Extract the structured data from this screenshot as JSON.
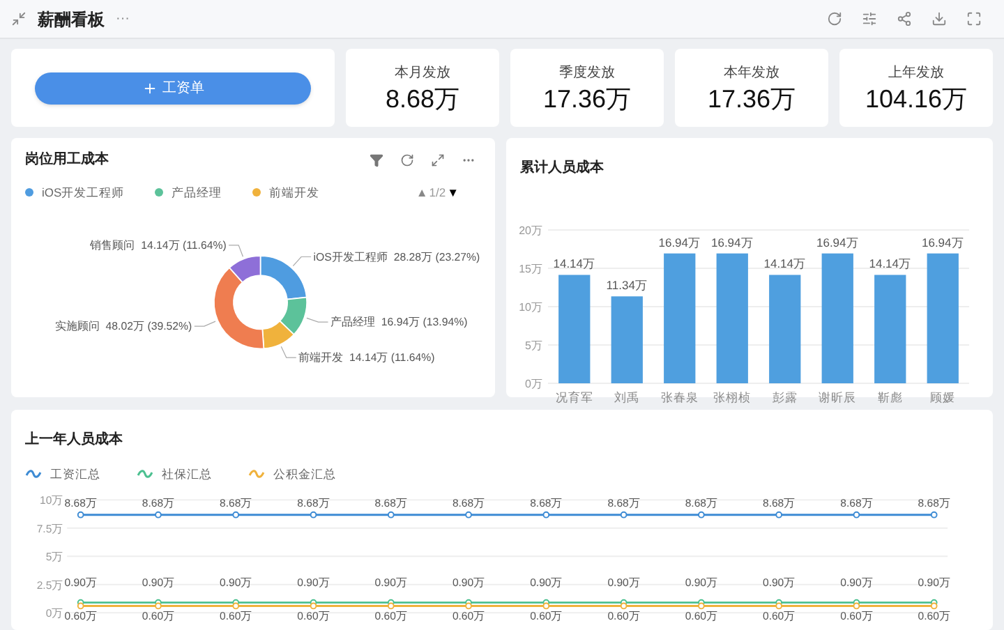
{
  "header": {
    "title": "薪酬看板",
    "more": "···"
  },
  "add_button": {
    "label": "工资单"
  },
  "stats": [
    {
      "label": "本月发放",
      "value": "8.68万"
    },
    {
      "label": "季度发放",
      "value": "17.36万"
    },
    {
      "label": "本年发放",
      "value": "17.36万"
    },
    {
      "label": "上年发放",
      "value": "104.16万"
    }
  ],
  "position_cost": {
    "title": "岗位用工成本",
    "legend": [
      {
        "label": "iOS开发工程师",
        "color": "#4f9ce0"
      },
      {
        "label": "产品经理",
        "color": "#5cc29a"
      },
      {
        "label": "前端开发",
        "color": "#f0b23c"
      }
    ],
    "pager": {
      "prev": "▲",
      "page": "1/2",
      "next": "▼",
      "prev_disabled": true,
      "next_disabled": false
    },
    "chart_data": {
      "type": "donut",
      "categories": [
        "iOS开发工程师",
        "产品经理",
        "前端开发",
        "实施顾问",
        "销售顾问"
      ],
      "values": [
        23.27,
        13.94,
        11.64,
        39.52,
        11.64
      ],
      "colors": [
        "#4f9ce0",
        "#5cc29a",
        "#f0b23c",
        "#ef7d50",
        "#8e6fd8"
      ],
      "value_labels": [
        "28.28万 (23.27%)",
        "16.94万 (13.94%)",
        "14.14万 (11.64%)",
        "48.02万 (39.52%)",
        "14.14万 (11.64%)"
      ]
    }
  },
  "cumulative_cost": {
    "title": "累计人员成本",
    "chart_data": {
      "type": "bar",
      "categories": [
        "况育军",
        "刘禹",
        "张春泉",
        "张栩桢",
        "彭露",
        "谢昕辰",
        "靳彪",
        "顾媛"
      ],
      "values": [
        14.14,
        11.34,
        16.94,
        16.94,
        14.14,
        16.94,
        14.14,
        16.94
      ],
      "color": "#4f9fdf",
      "ylim": [
        0,
        20
      ],
      "grid": true,
      "yticks": [
        {
          "value": 0,
          "label": "0万"
        },
        {
          "value": 5,
          "label": "5万"
        },
        {
          "value": 10,
          "label": "10万"
        },
        {
          "value": 15,
          "label": "15万"
        },
        {
          "value": 20,
          "label": "20万"
        }
      ],
      "value_labels": [
        "14.14万",
        "11.34万",
        "16.94万",
        "16.94万",
        "14.14万",
        "16.94万",
        "14.14万",
        "16.94万"
      ]
    }
  },
  "last_year_cost": {
    "title": "上一年人员成本",
    "chart_data": {
      "type": "line",
      "grid": true,
      "series": [
        {
          "name": "工资汇总",
          "color": "#3d8bd4",
          "marker": "circle",
          "values": [
            8.68,
            8.68,
            8.68,
            8.68,
            8.68,
            8.68,
            8.68,
            8.68,
            8.68,
            8.68,
            8.68,
            8.68
          ]
        },
        {
          "name": "社保汇总",
          "color": "#4cc090",
          "marker": "circle",
          "values": [
            0.9,
            0.9,
            0.9,
            0.9,
            0.9,
            0.9,
            0.9,
            0.9,
            0.9,
            0.9,
            0.9,
            0.9
          ]
        },
        {
          "name": "公积金汇总",
          "color": "#f0b23c",
          "marker": "circle",
          "values": [
            0.6,
            0.6,
            0.6,
            0.6,
            0.6,
            0.6,
            0.6,
            0.6,
            0.6,
            0.6,
            0.6,
            0.6
          ]
        }
      ],
      "ylim": [
        0,
        10
      ],
      "yticks": [
        {
          "value": 0,
          "label": "0万"
        },
        {
          "value": 2.5,
          "label": "2.5万"
        },
        {
          "value": 5,
          "label": "5万"
        },
        {
          "value": 7.5,
          "label": "7.5万"
        },
        {
          "value": 10,
          "label": "10万"
        }
      ],
      "value_labels": [
        [
          "8.68万",
          "8.68万",
          "8.68万",
          "8.68万",
          "8.68万",
          "8.68万",
          "8.68万",
          "8.68万",
          "8.68万",
          "8.68万",
          "8.68万",
          "8.68万"
        ],
        [
          "0.90万",
          "0.90万",
          "0.90万",
          "0.90万",
          "0.90万",
          "0.90万",
          "0.90万",
          "0.90万",
          "0.90万",
          "0.90万",
          "0.90万",
          "0.90万"
        ],
        [
          "0.60万",
          "0.60万",
          "0.60万",
          "0.60万",
          "0.60万",
          "0.60万",
          "0.60万",
          "0.60万",
          "0.60万",
          "0.60万",
          "0.60万",
          "0.60万"
        ]
      ]
    }
  }
}
